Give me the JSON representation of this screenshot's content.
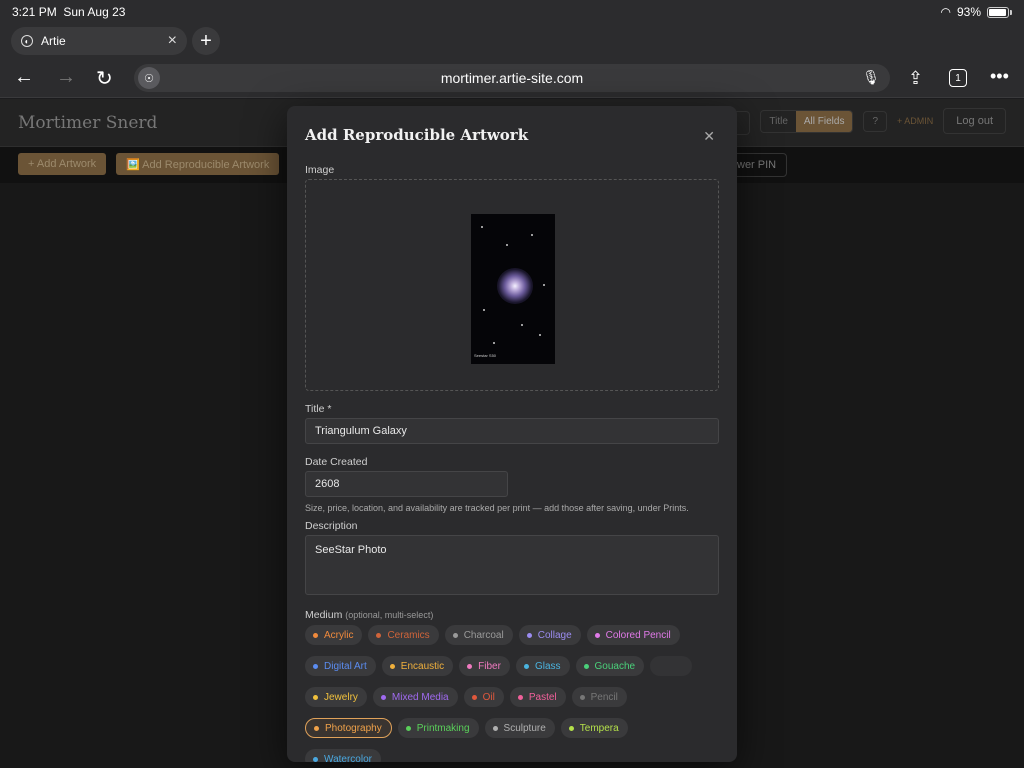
{
  "status": {
    "time": "3:21 PM",
    "date": "Sun Aug 23",
    "battery": "93%"
  },
  "browser": {
    "tab_title": "Artie",
    "url": "mortimer.artie-site.com",
    "tab_count": "1"
  },
  "site": {
    "title": "Mortimer Snerd",
    "search_modes": [
      "Title",
      "All Fields"
    ],
    "help_label": "?",
    "admin_label": "+ ADMIN",
    "logout_label": "Log out",
    "add_artwork_label": "+ Add Artwork",
    "add_repro_label": "🖼️ Add Reproducible Artwork",
    "pin_label": "wer PIN"
  },
  "modal": {
    "title": "Add Reproducible Artwork",
    "image_label": "Image",
    "thumb_caption": "Seestar S50",
    "title_label": "Title *",
    "title_value": "Triangulum Galaxy",
    "date_label": "Date Created",
    "date_value": "2608",
    "hint": "Size, price, location, and availability are tracked per print — add those after saving, under Prints.",
    "description_label": "Description",
    "description_value": "SeeStar Photo",
    "medium_label": "Medium",
    "medium_note": "(optional, multi-select)",
    "mediums": [
      [
        {
          "label": "Acrylic",
          "color": "#f08a3c"
        },
        {
          "label": "Ceramics",
          "color": "#d0643a"
        },
        {
          "label": "Charcoal",
          "color": "#9a9a9a"
        },
        {
          "label": "Collage",
          "color": "#9b8cf0"
        },
        {
          "label": "Colored Pencil",
          "color": "#e07ae8"
        }
      ],
      [
        {
          "label": "Digital Art",
          "color": "#5b8cf0"
        },
        {
          "label": "Encaustic",
          "color": "#f0b03c"
        },
        {
          "label": "Fiber",
          "color": "#f07ac0"
        },
        {
          "label": "Glass",
          "color": "#4ab4e0"
        },
        {
          "label": "Gouache",
          "color": "#4ad07a"
        },
        {
          "label": "",
          "color": "#3a3a3c"
        }
      ],
      [
        {
          "label": "Jewelry",
          "color": "#f0c03c"
        },
        {
          "label": "Mixed Media",
          "color": "#a06af0"
        },
        {
          "label": "Oil",
          "color": "#e0583c"
        },
        {
          "label": "Pastel",
          "color": "#f0609a"
        },
        {
          "label": "Pencil",
          "color": "#777777"
        }
      ],
      [
        {
          "label": "Photography",
          "color": "#f0a24a",
          "selected": true
        },
        {
          "label": "Printmaking",
          "color": "#5ad05a"
        },
        {
          "label": "Sculpture",
          "color": "#b0b0b0"
        },
        {
          "label": "Tempera",
          "color": "#b4e04a"
        }
      ],
      [
        {
          "label": "Watercolor",
          "color": "#4aa8e0"
        }
      ]
    ]
  }
}
